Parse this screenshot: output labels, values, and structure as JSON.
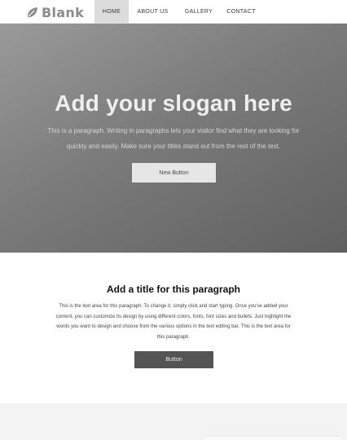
{
  "header": {
    "logo_text": "Blank",
    "logo_icon": "leaf-icon",
    "nav": [
      {
        "label": "HOME",
        "active": true
      },
      {
        "label": "ABOUT US",
        "active": false
      },
      {
        "label": "GALLERY",
        "active": false
      },
      {
        "label": "CONTACT",
        "active": false
      }
    ]
  },
  "hero": {
    "title": "Add your slogan here",
    "paragraph": "This is a paragraph. Writing in paragraphs lets your visitor find what they are looking for quickly and easily. Make sure your titles stand out from the rest of the text.",
    "button_label": "New Button"
  },
  "section2": {
    "title": "Add a title for this paragraph",
    "paragraph": "This is the text area for this paragraph. To change it, simply click and start typing. Once you've added your content, you can customize its design by using different colors, fonts, font sizes and bullets. Just highlight the words you want to design and choose from the various options in the text editing bar. This is the text area for this paragraph.",
    "button_label": "Button"
  },
  "colors": {
    "hero_background": "#7b7b7b",
    "active_nav_background": "#dcdcdc",
    "dark_button": "#545454",
    "logo_gray": "#8c8c8c"
  }
}
